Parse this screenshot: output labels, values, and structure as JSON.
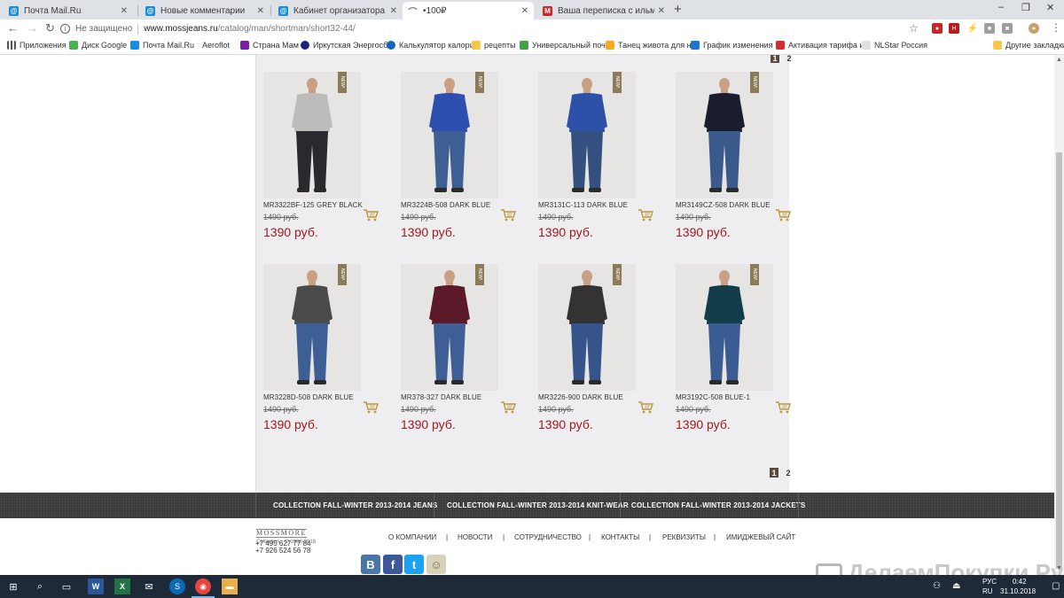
{
  "tabs": [
    {
      "label": "Почта Mail.Ru",
      "fav_color": "#168de2"
    },
    {
      "label": "Новые комментарии",
      "fav_color": "#168de2"
    },
    {
      "label": "Кабинет организатора | «Делаем Покупки»",
      "fav_color": "#168de2"
    },
    {
      "label": "•100₽",
      "fav_color": "#888888"
    },
    {
      "label": "Ваша переписка с ильмирочка...",
      "fav_color": "#c62828",
      "fav_text": "M"
    }
  ],
  "new_tab_symbol": "+",
  "window_controls": {
    "minimize": "–",
    "restore": "❐",
    "close": "✕"
  },
  "nav": {
    "back": "←",
    "forward": "→",
    "reload": "↻"
  },
  "address": {
    "security_label": "Не защищено",
    "domain": "www.mossjeans.ru",
    "path": "/catalog/man/shortman/short32-44/"
  },
  "bookmarks": [
    {
      "label": "Приложения",
      "color": "#555555"
    },
    {
      "label": "Диск Google",
      "color": "#4caf50"
    },
    {
      "label": "Почта Mail.Ru",
      "color": "#168de2"
    },
    {
      "label": "Aeroflot",
      "color": "#c62828"
    },
    {
      "label": "Страна Мам",
      "color": "#7b1fa2"
    },
    {
      "label": "Иркутская Энергосб",
      "color": "#1a237e"
    },
    {
      "label": "Калькулятор калори",
      "color": "#1565c0"
    },
    {
      "label": "рецепты",
      "color": "#f9c74f"
    },
    {
      "label": "Универсальный поч",
      "color": "#43a047"
    },
    {
      "label": "Танец живота для н",
      "color": "#f9a825"
    },
    {
      "label": "График изменения",
      "color": "#1976d2"
    },
    {
      "label": "Активация тарифа и",
      "color": "#d32f2f"
    },
    {
      "label": "NLStar Россия",
      "color": "#9e9e9e"
    },
    {
      "label": "Другие закладки",
      "color": "#f9c74f"
    }
  ],
  "pagination": {
    "pages": [
      "1",
      "2"
    ],
    "current": "1"
  },
  "products": [
    {
      "name": "MR3322BF-125 GREY BLACK",
      "old_price": "1490 руб.",
      "new_price": "1390 руб.",
      "badge": "NEW!",
      "sweater": "#bdbcbb",
      "jeans": "#2a2a2e"
    },
    {
      "name": "MR3224B-508 DARK BLUE",
      "old_price": "1490 руб.",
      "new_price": "1390 руб.",
      "badge": "NEW!",
      "sweater": "#2f4fb0",
      "jeans": "#3e5f94"
    },
    {
      "name": "MR3131C-113 DARK BLUE",
      "old_price": "1490 руб.",
      "new_price": "1390 руб.",
      "badge": "NEW!",
      "sweater": "#2d50a8",
      "jeans": "#33507e"
    },
    {
      "name": "MR3149CZ-508 DARK BLUE",
      "old_price": "1490 руб.",
      "new_price": "1390 руб.",
      "badge": "NEW!",
      "sweater": "#1a1d2e",
      "jeans": "#3b5a8c"
    },
    {
      "name": "MR3228D-508 DARK BLUE",
      "old_price": "1490 руб.",
      "new_price": "1390 руб.",
      "badge": "NEW!",
      "sweater": "#4b4b4b",
      "jeans": "#3d5f96"
    },
    {
      "name": "MR378-327 DARK BLUE",
      "old_price": "1490 руб.",
      "new_price": "1390 руб.",
      "badge": "NEW!",
      "sweater": "#5a1a2a",
      "jeans": "#3e5f96"
    },
    {
      "name": "MR3226-900 DARK BLUE",
      "old_price": "1490 руб.",
      "new_price": "1390 руб.",
      "badge": "NEW!",
      "sweater": "#333333",
      "jeans": "#36548a"
    },
    {
      "name": "MR3192C-508 BLUE-1",
      "old_price": "1490 руб.",
      "new_price": "1390 руб.",
      "badge": "NEW!",
      "sweater": "#123c48",
      "jeans": "#3a5c92"
    }
  ],
  "footer_categories": [
    "COLLECTION FALL-WINTER 2013-2014 JEANS",
    "COLLECTION FALL-WINTER 2013-2014 KNIT-WEAR",
    "COLLECTION FALL-WINTER 2013-2014 JACKETS"
  ],
  "logo": {
    "name": "MOSSMORE",
    "sub": "Collection",
    "years": "© 1996-2018"
  },
  "phones": [
    "+7 495 627 77 84",
    "+7 926 524 56 78"
  ],
  "footer_menu": [
    "О КОМПАНИИ",
    "НОВОСТИ",
    "СОТРУДНИЧЕСТВО",
    "КОНТАКТЫ",
    "РЕКВИЗИТЫ",
    "ИМИДЖЕВЫЙ САЙТ"
  ],
  "footer_menu_separator": "|",
  "social": [
    {
      "name": "vkontakte",
      "glyph": "В",
      "color": "#4a76a8"
    },
    {
      "name": "facebook",
      "glyph": "f",
      "color": "#3b5998"
    },
    {
      "name": "twitter",
      "glyph": "t",
      "color": "#1da1f2"
    },
    {
      "name": "odnoklassniki",
      "glyph": "☺",
      "color": "#b8b39a"
    }
  ],
  "watermark": "ДелаемПокупки.Ру",
  "taskbar": {
    "lang": "РУС",
    "region": "RU",
    "time": "0:42",
    "date": "31.10.2018"
  }
}
